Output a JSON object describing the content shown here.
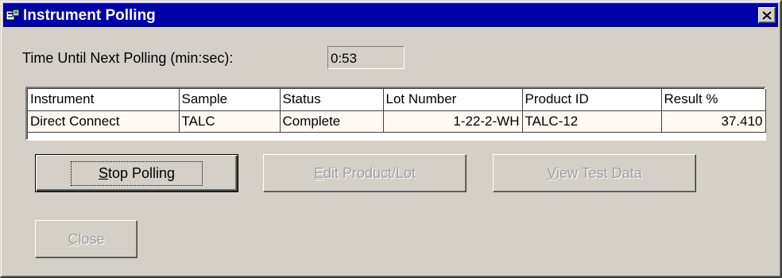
{
  "window": {
    "title": "Instrument Polling"
  },
  "timer": {
    "label": "Time Until Next Polling (min:sec):",
    "value": "0:53"
  },
  "grid": {
    "columns": [
      "Instrument",
      "Sample",
      "Status",
      "Lot Number",
      "Product ID",
      "Result %"
    ],
    "rows": [
      [
        "Direct Connect",
        "TALC",
        "Complete",
        "1-22-2-WH",
        "TALC-12",
        "37.410"
      ]
    ]
  },
  "buttons": {
    "stop_polling": {
      "access_key": "S",
      "rest": "top Polling"
    },
    "edit_product_lot": {
      "access_key": "E",
      "rest": "dit Product/Lot"
    },
    "view_test_data": {
      "access_key": "V",
      "rest": "iew Test Data"
    },
    "close": {
      "access_key": "C",
      "rest": "lose"
    }
  },
  "colors": {
    "titlebar": "#0000a8",
    "face": "#d4d0c8",
    "row_bg": "#fffaf0"
  }
}
